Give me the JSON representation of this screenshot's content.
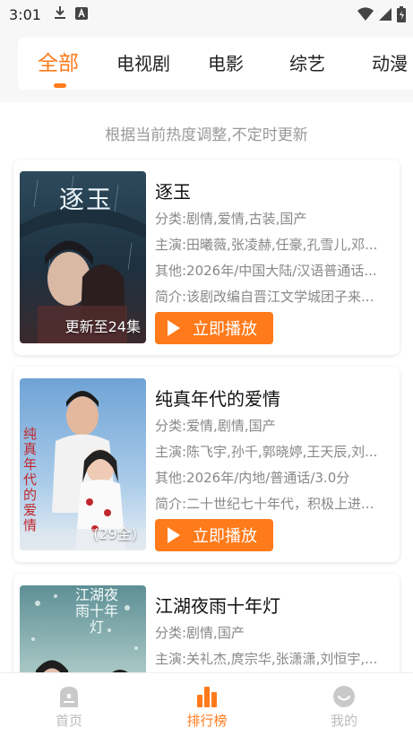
{
  "status_bar": {
    "time": "3:01"
  },
  "tabs": [
    {
      "label": "全部",
      "active": true
    },
    {
      "label": "电视剧",
      "active": false
    },
    {
      "label": "电影",
      "active": false
    },
    {
      "label": "综艺",
      "active": false
    },
    {
      "label": "动漫",
      "active": false
    }
  ],
  "hint": "根据当前热度调整,不定时更新",
  "items": [
    {
      "title": "逐玉",
      "category": "分类:剧情,爱情,古装,国产",
      "cast": "主演:田曦薇,张凌赫,任豪,孔雪儿,邓...",
      "other": "其他:2026年/中国大陆/汉语普通话...",
      "intro": "简介:该剧改编自晋江文学城团子来...",
      "badge": "更新至24集",
      "play_label": "立即播放",
      "poster_text": "逐玉"
    },
    {
      "title": "纯真年代的爱情",
      "category": "分类:爱情,剧情,国产",
      "cast": "主演:陈飞宇,孙千,郭晓婷,王天辰,刘...",
      "other": "其他:2026年/内地/普通话/3.0分",
      "intro": "简介:二十世纪七十年代，积极上进...",
      "badge": "(29全)",
      "play_label": "立即播放",
      "poster_text": "纯真年代的爱情"
    },
    {
      "title": "江湖夜雨十年灯",
      "category": "分类:剧情,国产",
      "cast": "主演:关礼杰,庹宗华,张潇潇,刘恒宇,...",
      "poster_text": "江湖夜雨十年灯"
    }
  ],
  "bottom_nav": [
    {
      "label": "首页",
      "icon": "home-icon",
      "active": false
    },
    {
      "label": "排行榜",
      "icon": "ranking-icon",
      "active": true
    },
    {
      "label": "我的",
      "icon": "profile-icon",
      "active": false
    }
  ],
  "colors": {
    "accent": "#ff7a1a",
    "muted": "#999999"
  }
}
